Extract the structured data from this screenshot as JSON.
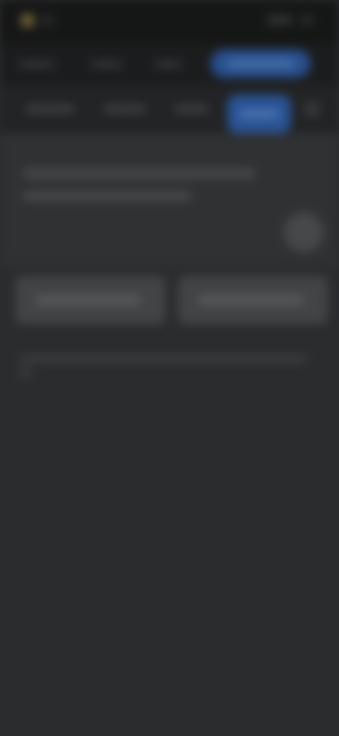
{
  "theme": {
    "background": "#2e2f31",
    "accent": "#2d5fb0",
    "brand": "#8a7440"
  },
  "status_bar": {
    "logo_icon": "brand-logo-icon"
  },
  "top_nav": {
    "links": [
      {
        "id": "nav-link-1"
      },
      {
        "id": "nav-link-2"
      },
      {
        "id": "nav-link-3"
      }
    ],
    "cta_icon": "primary-action"
  },
  "tabs": {
    "items": [
      {
        "id": "tab-1",
        "active": false
      },
      {
        "id": "tab-2",
        "active": false
      },
      {
        "id": "tab-3",
        "active": false
      },
      {
        "id": "tab-4",
        "active": true
      }
    ],
    "more_icon": "more-icon"
  },
  "card": {
    "fab_icon": "circle-button-icon"
  },
  "options": [
    {
      "id": "option-left"
    },
    {
      "id": "option-right"
    }
  ],
  "overlay": {
    "state": "blurred"
  }
}
